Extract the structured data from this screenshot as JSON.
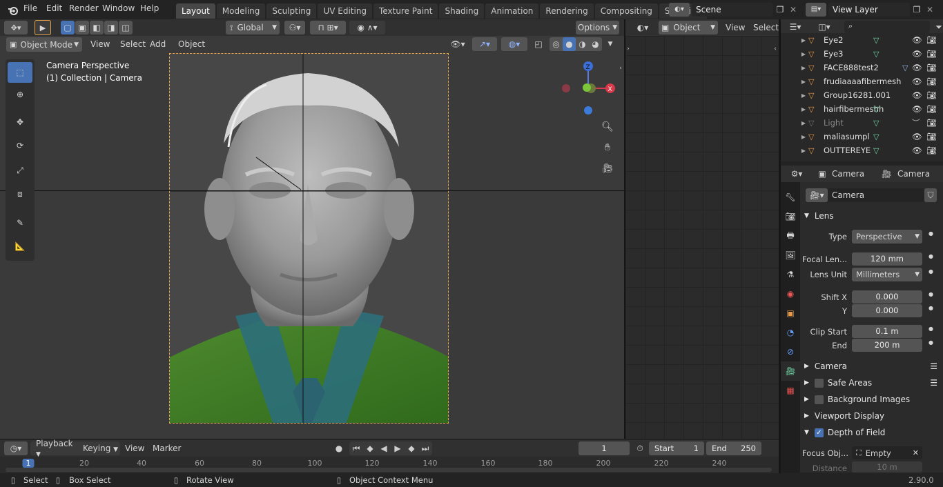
{
  "menu": [
    "File",
    "Edit",
    "Render",
    "Window",
    "Help"
  ],
  "workspaces": [
    "Layout",
    "Modeling",
    "Sculpting",
    "UV Editing",
    "Texture Paint",
    "Shading",
    "Animation",
    "Rendering",
    "Compositing",
    "Scripting"
  ],
  "active_workspace": "Layout",
  "scene_name": "Scene",
  "view_layer": "View Layer",
  "viewport": {
    "orientation": "Global",
    "options_label": "Options",
    "mode": "Object Mode",
    "menus": [
      "View",
      "Select",
      "Add",
      "Object"
    ],
    "overlay_title": "Camera Perspective",
    "overlay_subtitle": "(1) Collection | Camera",
    "gizmo_z": "Z",
    "gizmo_x": "X"
  },
  "node_header": {
    "mode": "Object",
    "view": "View",
    "select": "Select"
  },
  "outliner": {
    "rows": [
      {
        "name": "Eye2",
        "color": "#6fd8a8"
      },
      {
        "name": "Eye3",
        "color": "#6fd8a8"
      },
      {
        "name": "FACE888test2",
        "color": "#9ab9e8"
      },
      {
        "name": "frudiaaaafibermesh",
        "color": ""
      },
      {
        "name": "Group16281.001",
        "color": ""
      },
      {
        "name": "hairfibermeshh",
        "color": "#6fd8a8"
      },
      {
        "name": "Light",
        "color": "#6fd8a8"
      },
      {
        "name": "maliasumpl",
        "color": "#6fd8a8"
      },
      {
        "name": "OUTTEREYE",
        "color": "#6fd8a8"
      }
    ]
  },
  "properties": {
    "breadcrumb_object": "Camera",
    "breadcrumb_data": "Camera",
    "datablock_name": "Camera",
    "lens_title": "Lens",
    "type_label": "Type",
    "type_value": "Perspective",
    "focal_label": "Focal Len...",
    "focal_value": "120 mm",
    "lens_unit_label": "Lens Unit",
    "lens_unit_value": "Millimeters",
    "shift_x_label": "Shift X",
    "shift_x_value": "0.000",
    "shift_y_label": "Y",
    "shift_y_value": "0.000",
    "clip_start_label": "Clip Start",
    "clip_start_value": "0.1 m",
    "clip_end_label": "End",
    "clip_end_value": "200 m",
    "panels": [
      "Camera",
      "Safe Areas",
      "Background Images",
      "Viewport Display",
      "Depth of Field"
    ],
    "focus_label": "Focus Obj...",
    "focus_value": "Empty",
    "distance_label": "Distance",
    "distance_value": "10 m"
  },
  "timeline": {
    "menus": [
      "Playback",
      "Keying",
      "View",
      "Marker"
    ],
    "current_frame": "1",
    "start_label": "Start",
    "start_value": "1",
    "end_label": "End",
    "end_value": "250",
    "ruler": [
      "1",
      "20",
      "40",
      "60",
      "80",
      "100",
      "120",
      "140",
      "160",
      "180",
      "200",
      "220",
      "240"
    ]
  },
  "status": {
    "select": "Select",
    "box_select": "Box Select",
    "rotate": "Rotate View",
    "context": "Object Context Menu",
    "version": "2.90.0"
  }
}
